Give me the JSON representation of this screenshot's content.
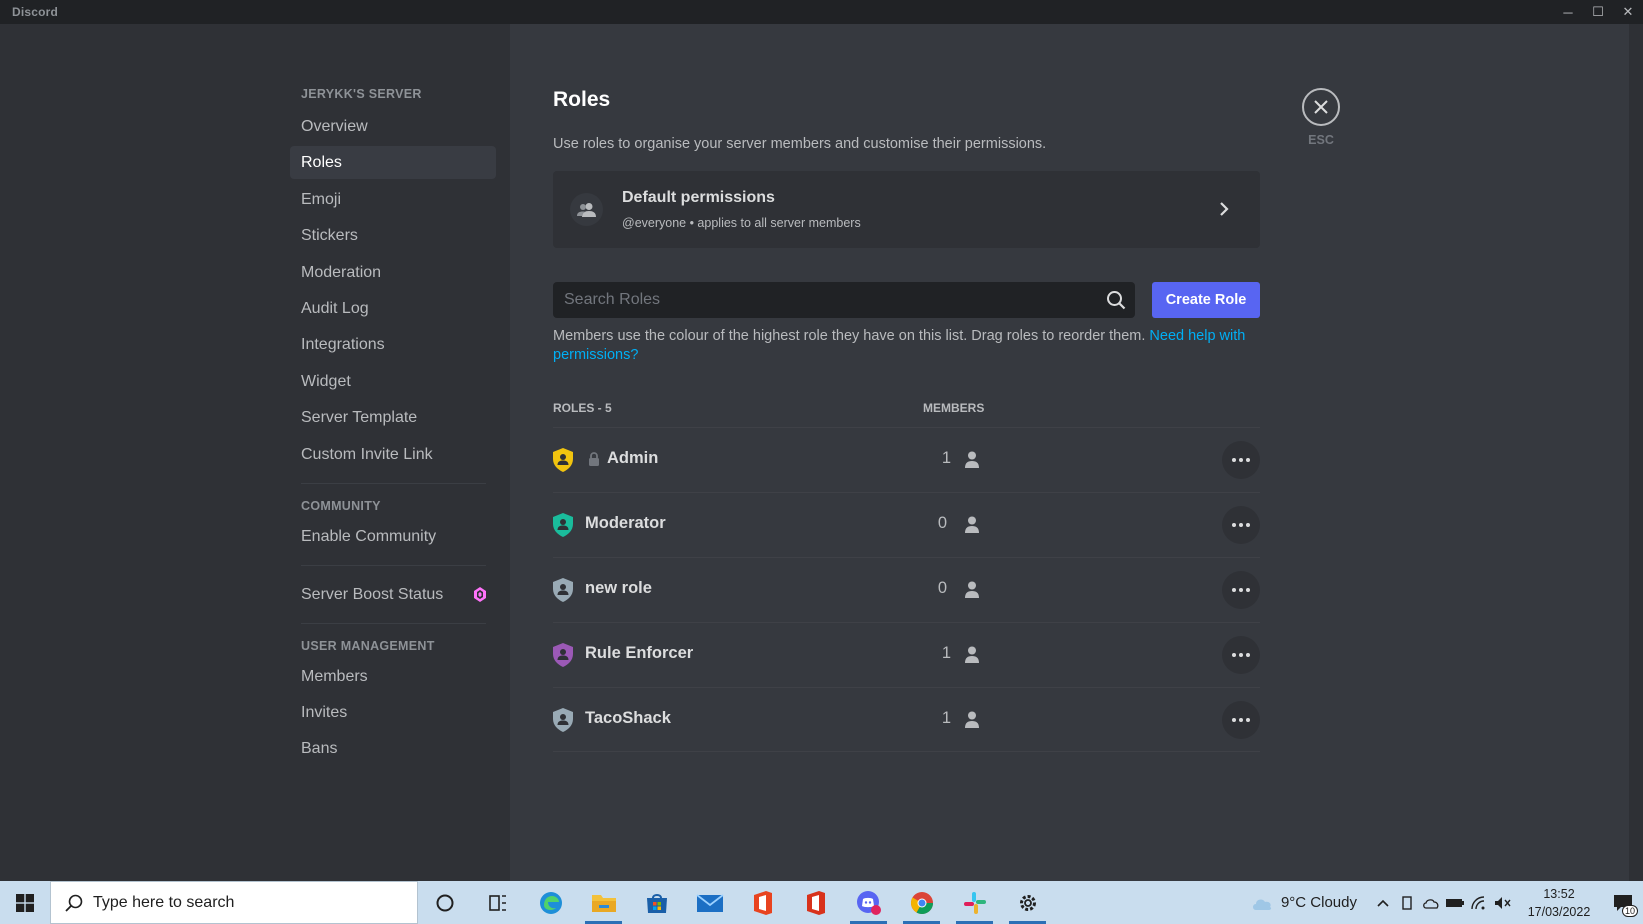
{
  "window": {
    "app_name": "Discord",
    "controls": {
      "minimize": "─",
      "maximize": "☐",
      "close": "✕"
    }
  },
  "sidebar": {
    "server_header": "JERYKK'S SERVER",
    "items": [
      {
        "label": "Overview",
        "active": false
      },
      {
        "label": "Roles",
        "active": true
      },
      {
        "label": "Emoji",
        "active": false
      },
      {
        "label": "Stickers",
        "active": false
      },
      {
        "label": "Moderation",
        "active": false
      },
      {
        "label": "Audit Log",
        "active": false
      },
      {
        "label": "Integrations",
        "active": false
      },
      {
        "label": "Widget",
        "active": false
      },
      {
        "label": "Server Template",
        "active": false
      },
      {
        "label": "Custom Invite Link",
        "active": false
      }
    ],
    "community_header": "COMMUNITY",
    "community_items": [
      {
        "label": "Enable Community"
      }
    ],
    "boost_item": {
      "label": "Server Boost Status",
      "icon": "boost-gem-icon"
    },
    "user_mgmt_header": "USER MANAGEMENT",
    "user_mgmt_items": [
      {
        "label": "Members"
      },
      {
        "label": "Invites"
      },
      {
        "label": "Bans"
      }
    ]
  },
  "main": {
    "title": "Roles",
    "description": "Use roles to organise your server members and customise their permissions.",
    "default_permissions": {
      "title": "Default permissions",
      "subtitle": "@everyone • applies to all server members"
    },
    "search": {
      "placeholder": "Search Roles",
      "value": ""
    },
    "create_role_label": "Create Role",
    "help_text": "Members use the colour of the highest role they have on this list. Drag roles to reorder them. ",
    "help_link": "Need help with permissions?",
    "table": {
      "roles_header": "ROLES - 5",
      "members_header": "MEMBERS",
      "roles": [
        {
          "name": "Admin",
          "members": "1",
          "color": "#f1c40f",
          "locked": true
        },
        {
          "name": "Moderator",
          "members": "0",
          "color": "#1abc9c",
          "locked": false
        },
        {
          "name": "new role",
          "members": "0",
          "color": "#99aab5",
          "locked": false
        },
        {
          "name": "Rule Enforcer",
          "members": "1",
          "color": "#9b59b6",
          "locked": false
        },
        {
          "name": "TacoShack",
          "members": "1",
          "color": "#99aab5",
          "locked": false
        }
      ]
    },
    "close": {
      "esc_label": "ESC"
    }
  },
  "taskbar": {
    "search_placeholder": "Type here to search",
    "weather": "9°C  Cloudy",
    "time": "13:52",
    "date": "17/03/2022",
    "notification_count": "10",
    "colors": {
      "accent": "#5865f2",
      "link": "#00aff4"
    }
  }
}
